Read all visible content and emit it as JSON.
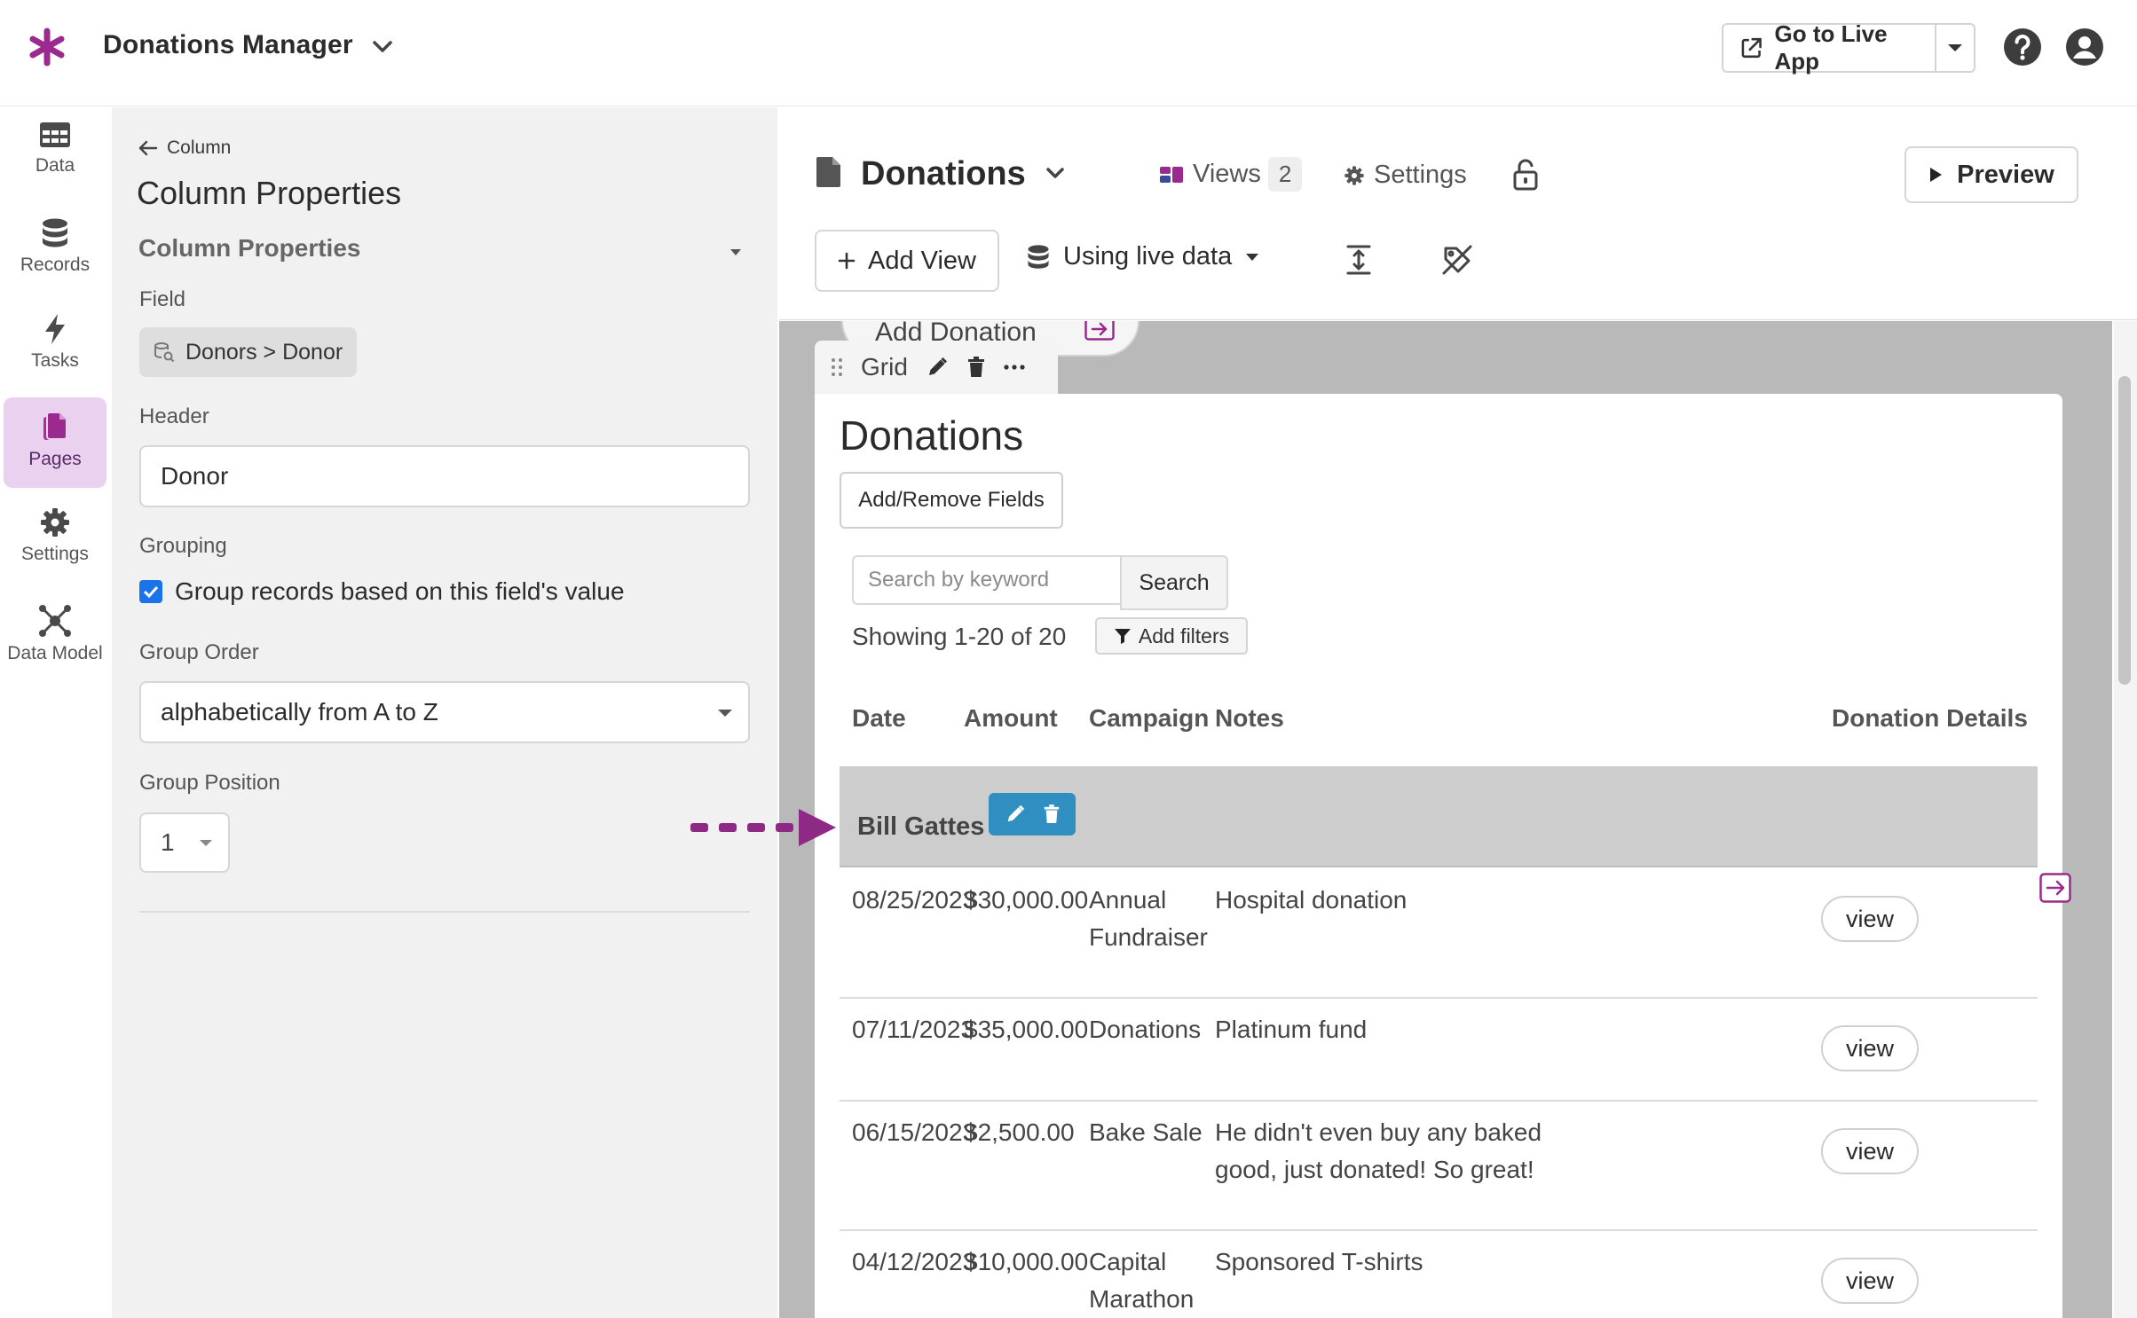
{
  "app": {
    "title": "Donations Manager",
    "live_app_label": "Go to Live App"
  },
  "nav": {
    "items": [
      {
        "label": "Data",
        "icon": "table-icon"
      },
      {
        "label": "Records",
        "icon": "database-icon"
      },
      {
        "label": "Tasks",
        "icon": "bolt-icon"
      },
      {
        "label": "Pages",
        "icon": "pages-icon",
        "active": true
      },
      {
        "label": "Settings",
        "icon": "gear-icon"
      },
      {
        "label": "Data Model",
        "icon": "nodes-icon"
      }
    ]
  },
  "panel": {
    "back_label": "Column",
    "title": "Column Properties",
    "section_title": "Column Properties",
    "field_label": "Field",
    "field_value": "Donors > Donor",
    "header_label": "Header",
    "header_value": "Donor",
    "grouping_label": "Grouping",
    "grouping_checkbox_label": "Group records based on this field's value",
    "grouping_checked": true,
    "group_order_label": "Group Order",
    "group_order_value": "alphabetically from A to Z",
    "group_position_label": "Group Position",
    "group_position_value": "1"
  },
  "editor": {
    "page_name": "Donations",
    "views_label": "Views",
    "views_count": "2",
    "settings_label": "Settings",
    "preview_label": "Preview",
    "add_view_label": "Add View",
    "data_source_label": "Using live data"
  },
  "canvas": {
    "ghost_button_label": "Add Donation",
    "grid_tab_label": "Grid",
    "grid": {
      "title": "Donations",
      "add_remove_fields_label": "Add/Remove Fields",
      "search_placeholder": "Search by keyword",
      "search_button_label": "Search",
      "showing_text": "Showing 1-20 of 20",
      "add_filters_label": "Add filters",
      "columns": [
        "Date",
        "Amount",
        "Campaign",
        "Notes",
        "Donation Details"
      ],
      "group_name": "Bill Gattes",
      "rows": [
        {
          "date": "08/25/2023",
          "amount": "$30,000.00",
          "campaign": "Annual Fundraiser",
          "notes": "Hospital donation",
          "action": "view"
        },
        {
          "date": "07/11/2023",
          "amount": "$35,000.00",
          "campaign": "Donations",
          "notes": "Platinum fund",
          "action": "view"
        },
        {
          "date": "06/15/2023",
          "amount": "$2,500.00",
          "campaign": "Bake Sale",
          "notes": "He didn't even buy any baked good, just donated! So great!",
          "action": "view"
        },
        {
          "date": "04/12/2023",
          "amount": "$10,000.00",
          "campaign": "Capital Marathon",
          "notes": "Sponsored T-shirts",
          "action": "view"
        }
      ]
    }
  },
  "colors": {
    "brand": "#9b2a8e",
    "nav_active_bg": "#ead1ef",
    "group_tools_bg": "#2f8fc1",
    "annotation_arrow": "#8e2a86",
    "checkbox": "#1a73e8"
  }
}
